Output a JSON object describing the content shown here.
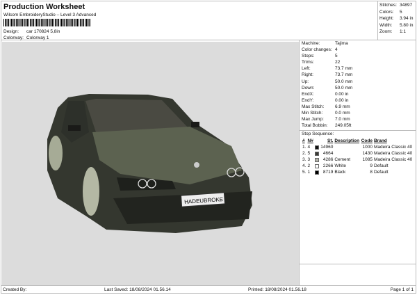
{
  "header": {
    "title": "Production Worksheet",
    "subtitle": "Wilcom EmbroideryStudio – Level 3 Advanced",
    "design_label": "Design:",
    "design": "car 170824 5,8in",
    "colorway_label": "Colorway:",
    "colorway": "Colorway 1"
  },
  "stats": [
    {
      "k": "Stitches:",
      "v": "34897"
    },
    {
      "k": "Colors:",
      "v": "5"
    },
    {
      "k": "Height:",
      "v": "3.94 in"
    },
    {
      "k": "Width:",
      "v": "5.80 in"
    },
    {
      "k": "Zoom:",
      "v": "1:1"
    }
  ],
  "info": [
    {
      "k": "Machine:",
      "v": "Tajima"
    },
    {
      "k": "Color changes:",
      "v": "4"
    },
    {
      "k": "Stops:",
      "v": "5"
    },
    {
      "k": "Trims:",
      "v": "22"
    },
    {
      "k": "Left:",
      "v": "73.7 mm"
    },
    {
      "k": "Right:",
      "v": "73.7 mm"
    },
    {
      "k": "Up:",
      "v": "50.0 mm"
    },
    {
      "k": "Down:",
      "v": "50.0 mm"
    },
    {
      "k": "EndX:",
      "v": "0.00 in"
    },
    {
      "k": "EndY:",
      "v": "0.00 in"
    },
    {
      "k": "Max Stitch:",
      "v": "6.9 mm"
    },
    {
      "k": "Min Stitch:",
      "v": "0.0 mm"
    },
    {
      "k": "Max Jump:",
      "v": "7.0 mm"
    },
    {
      "k": "Total Bobbin:",
      "v": "249.05ft"
    }
  ],
  "sequence": {
    "title": "Stop Sequence:",
    "headers": [
      "#",
      "N#",
      "St.",
      "Description",
      "Code",
      "Brand"
    ],
    "rows": [
      {
        "n": "1.",
        "nn": "4",
        "color": "#111111",
        "st": "14960",
        "desc": "",
        "code": "1000",
        "brand": "Madeira Classic 40"
      },
      {
        "n": "2.",
        "nn": "5",
        "color": "#3a3a36",
        "st": "4664",
        "desc": "",
        "code": "1430",
        "brand": "Madeira Classic 40"
      },
      {
        "n": "3.",
        "nn": "3",
        "color": "#b4b4aa",
        "st": "4286",
        "desc": "Cement",
        "code": "1085",
        "brand": "Madeira Classic 40"
      },
      {
        "n": "4.",
        "nn": "2",
        "color": "#ffffff",
        "st": "2266",
        "desc": "White",
        "code": "9",
        "brand": "Default"
      },
      {
        "n": "5.",
        "nn": "1",
        "color": "#000000",
        "st": "8719",
        "desc": "Black",
        "code": "8",
        "brand": "Default"
      }
    ]
  },
  "design_preview": {
    "plate": "HADEUBROKE"
  },
  "footer": {
    "created": "Created By:",
    "saved": "Last Saved: 18/08/2024 01.56.14",
    "printed": "Printed: 18/08/2024 01.56.18",
    "page": "Page 1 of 1"
  }
}
